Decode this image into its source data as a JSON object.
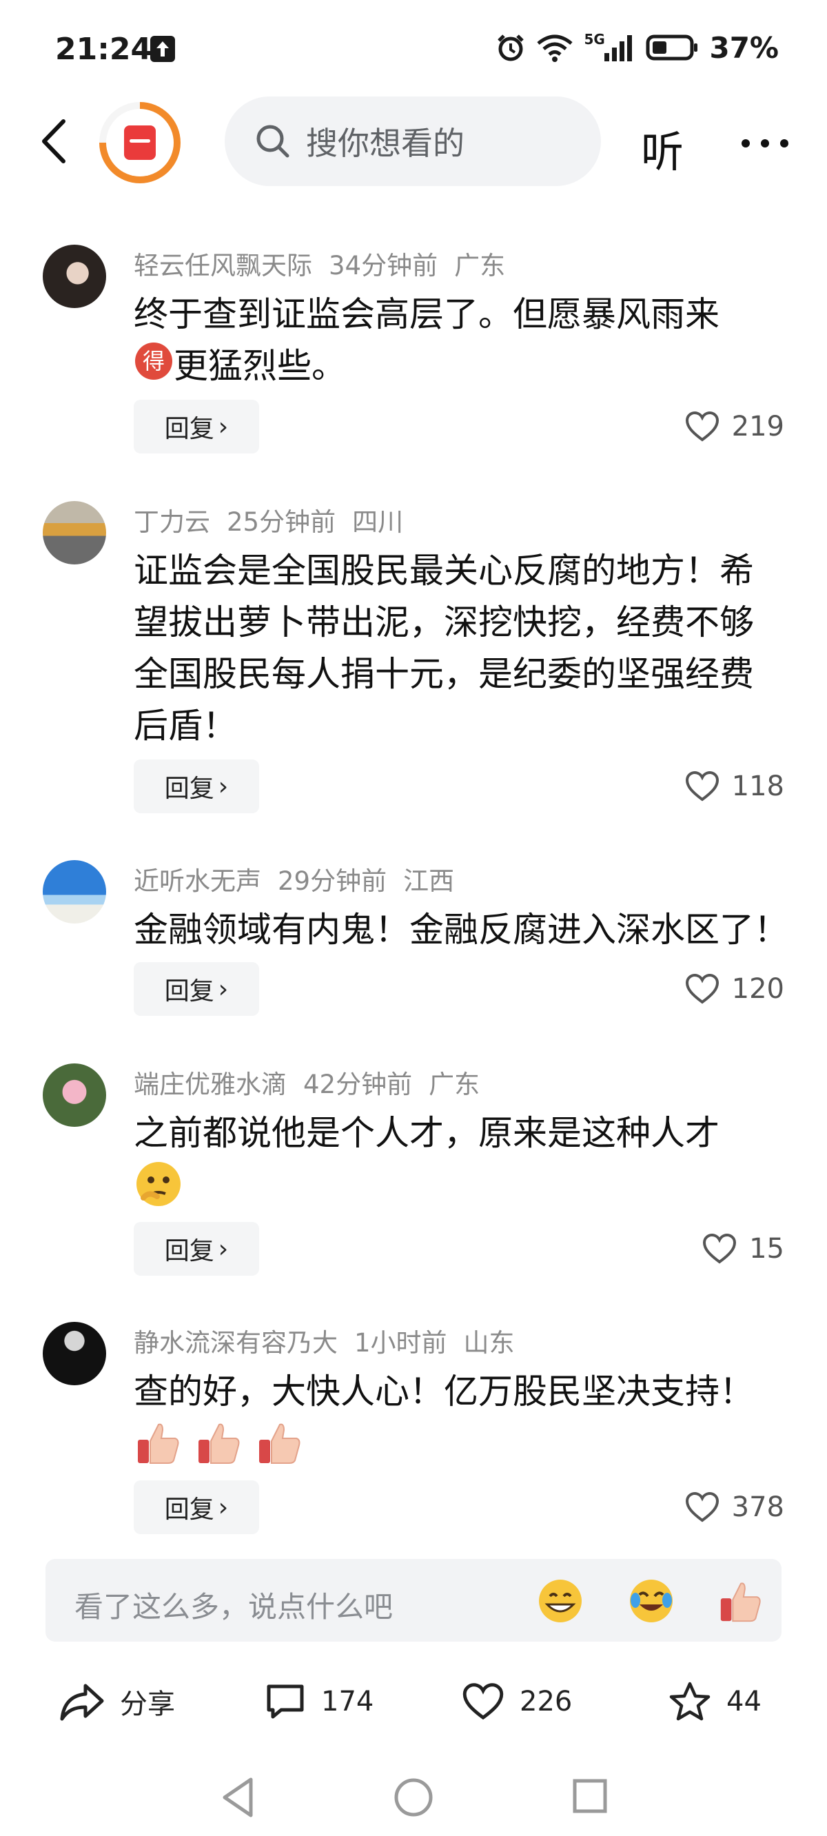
{
  "status_bar": {
    "time": "21:24",
    "network": "5G",
    "battery": "37%"
  },
  "nav": {
    "search_placeholder": "搜你想看的",
    "listen_label": "听"
  },
  "comments": [
    {
      "username": "轻云任风飘天际",
      "time": "34分钟前",
      "location": "广东",
      "text_line1": "终于查到证监会高层了。但愿暴风雨来",
      "text_line2": "更猛烈些。",
      "reply_label": "回复",
      "likes": "219"
    },
    {
      "username": "丁力云",
      "time": "25分钟前",
      "location": "四川",
      "text_line1": "证监会是全国股民最关心反腐的地方！希",
      "text_line2": "望拔出萝卜带出泥，深挖快挖，经费不够",
      "text_line3": "全国股民每人捐十元，是纪委的坚强经费",
      "text_line4": "后盾！",
      "reply_label": "回复",
      "likes": "118"
    },
    {
      "username": "近听水无声",
      "time": "29分钟前",
      "location": "江西",
      "text_line1": "金融领域有内鬼！金融反腐进入深水区了！",
      "reply_label": "回复",
      "likes": "120"
    },
    {
      "username": "端庄优雅水滴",
      "time": "42分钟前",
      "location": "广东",
      "text_line1": "之前都说他是个人才，原来是这种人才",
      "reply_label": "回复",
      "likes": "15"
    },
    {
      "username": "静水流深有容乃大",
      "time": "1小时前",
      "location": "山东",
      "text_line1": "查的好，大快人心！亿万股民坚决支持！",
      "reply_label": "回复",
      "likes": "378"
    }
  ],
  "comment_input": {
    "placeholder": "看了这么多，说点什么吧"
  },
  "actions": {
    "share_label": "分享",
    "comment_count": "174",
    "like_count": "226",
    "favorite_count": "44"
  },
  "icons": {
    "accent": "#f28a2a",
    "brand_red": "#ea3b3b"
  }
}
